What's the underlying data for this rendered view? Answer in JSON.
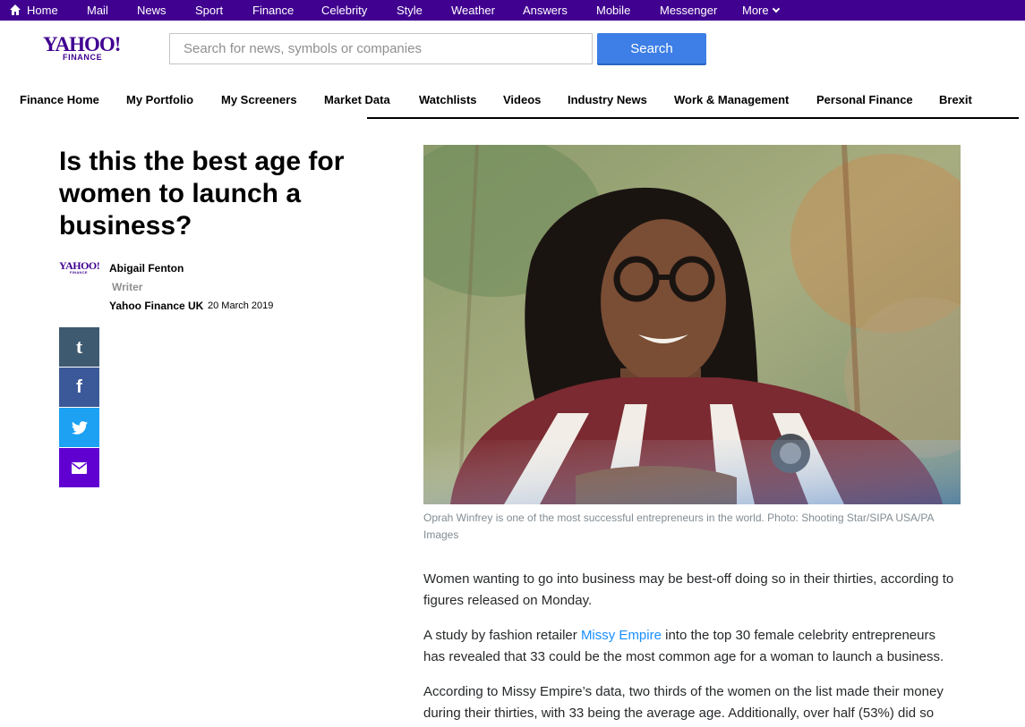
{
  "topbar": {
    "items": [
      "Home",
      "Mail",
      "News",
      "Sport",
      "Finance",
      "Celebrity",
      "Style",
      "Weather",
      "Answers",
      "Mobile",
      "Messenger",
      "More"
    ]
  },
  "header": {
    "logo_main": "YAHOO!",
    "logo_sub": "FINANCE",
    "search_placeholder": "Search for news, symbols or companies",
    "search_button": "Search"
  },
  "nav": {
    "items": [
      "Finance Home",
      "My Portfolio",
      "My Screeners",
      "Market Data",
      "Watchlists",
      "Videos",
      "Industry News",
      "Work & Management",
      "Personal Finance",
      "Brexit"
    ]
  },
  "article": {
    "title": "Is this the best age for women to launch a business?",
    "author": {
      "logo_main": "YAHOO!",
      "logo_sub": "FINANCE",
      "name": "Abigail Fenton",
      "role": "Writer",
      "source": "Yahoo Finance UK",
      "date": "20 March 2019"
    },
    "share": {
      "tumblr": "t",
      "facebook": "f"
    },
    "caption": "Oprah Winfrey is one of the most successful entrepreneurs in the world. Photo: Shooting Star/SIPA USA/PA Images",
    "paragraphs": {
      "p1": "Women wanting to go into business may be best-off doing so in their thirties, according to figures released on Monday.",
      "p2_before": "A study by fashion retailer ",
      "p2_link": "Missy Empire",
      "p2_after": " into the top 30 female celebrity entrepreneurs has revealed that 33 could be the most common age for a woman to launch a business.",
      "p3": "According to Missy Empire’s data, two thirds of the women on the list made their money during their thirties, with 33 being the average age. Additionally, over half (53%) did so"
    }
  },
  "colors": {
    "brand_purple": "#400090",
    "search_blue": "#3d7fe6",
    "link_blue": "#188fff",
    "tumblr": "#3e5a70",
    "facebook": "#3b5998",
    "twitter": "#1da1f2",
    "mail": "#6001d2"
  }
}
